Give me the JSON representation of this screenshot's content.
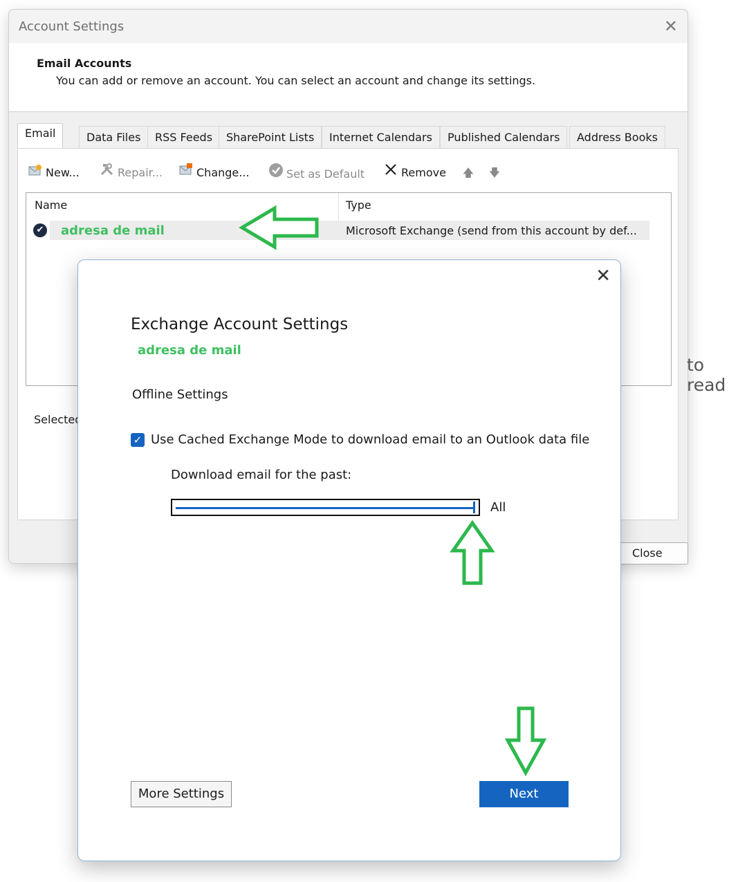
{
  "outer_window": {
    "title": "Account Settings",
    "close_glyph": "✕",
    "header_title": "Email Accounts",
    "header_desc": "You can add or remove an account. You can select an account and change its settings.",
    "tabs": [
      "Email",
      "Data Files",
      "RSS Feeds",
      "SharePoint Lists",
      "Internet Calendars",
      "Published Calendars",
      "Address Books"
    ],
    "toolbar": {
      "new": "New...",
      "repair": "Repair...",
      "change": "Change...",
      "set_default": "Set as Default",
      "remove": "Remove",
      "up_glyph": "🡅",
      "down_glyph": "🡇"
    },
    "list": {
      "col_name": "Name",
      "col_type": "Type",
      "rows": [
        {
          "name": "adresa de mail",
          "type": "Microsoft Exchange (send from this account by def..."
        }
      ]
    },
    "selected_label": "Selected",
    "close_button": "Close",
    "background_text": "to read"
  },
  "dialog": {
    "close_glyph": "✕",
    "title": "Exchange Account Settings",
    "account": "adresa de mail",
    "section": "Offline Settings",
    "cached_mode_label": "Use Cached Exchange Mode to download email to an Outlook data file",
    "cached_mode_checked": true,
    "download_label": "Download email for the past:",
    "slider_value_label": "All",
    "slider_fraction": 1.0,
    "more_settings": "More Settings",
    "next": "Next"
  },
  "colors": {
    "accent_blue": "#1565c0",
    "annotation_green": "#2db84d",
    "account_green": "#3fbf5f"
  },
  "icons": {
    "new": "envelope-plus-icon",
    "repair": "tools-icon",
    "change": "envelope-edit-icon",
    "set_default": "check-circle-icon",
    "remove": "x-icon",
    "up": "arrow-up-icon",
    "down": "arrow-down-icon",
    "account_status": "check-badge-icon"
  }
}
